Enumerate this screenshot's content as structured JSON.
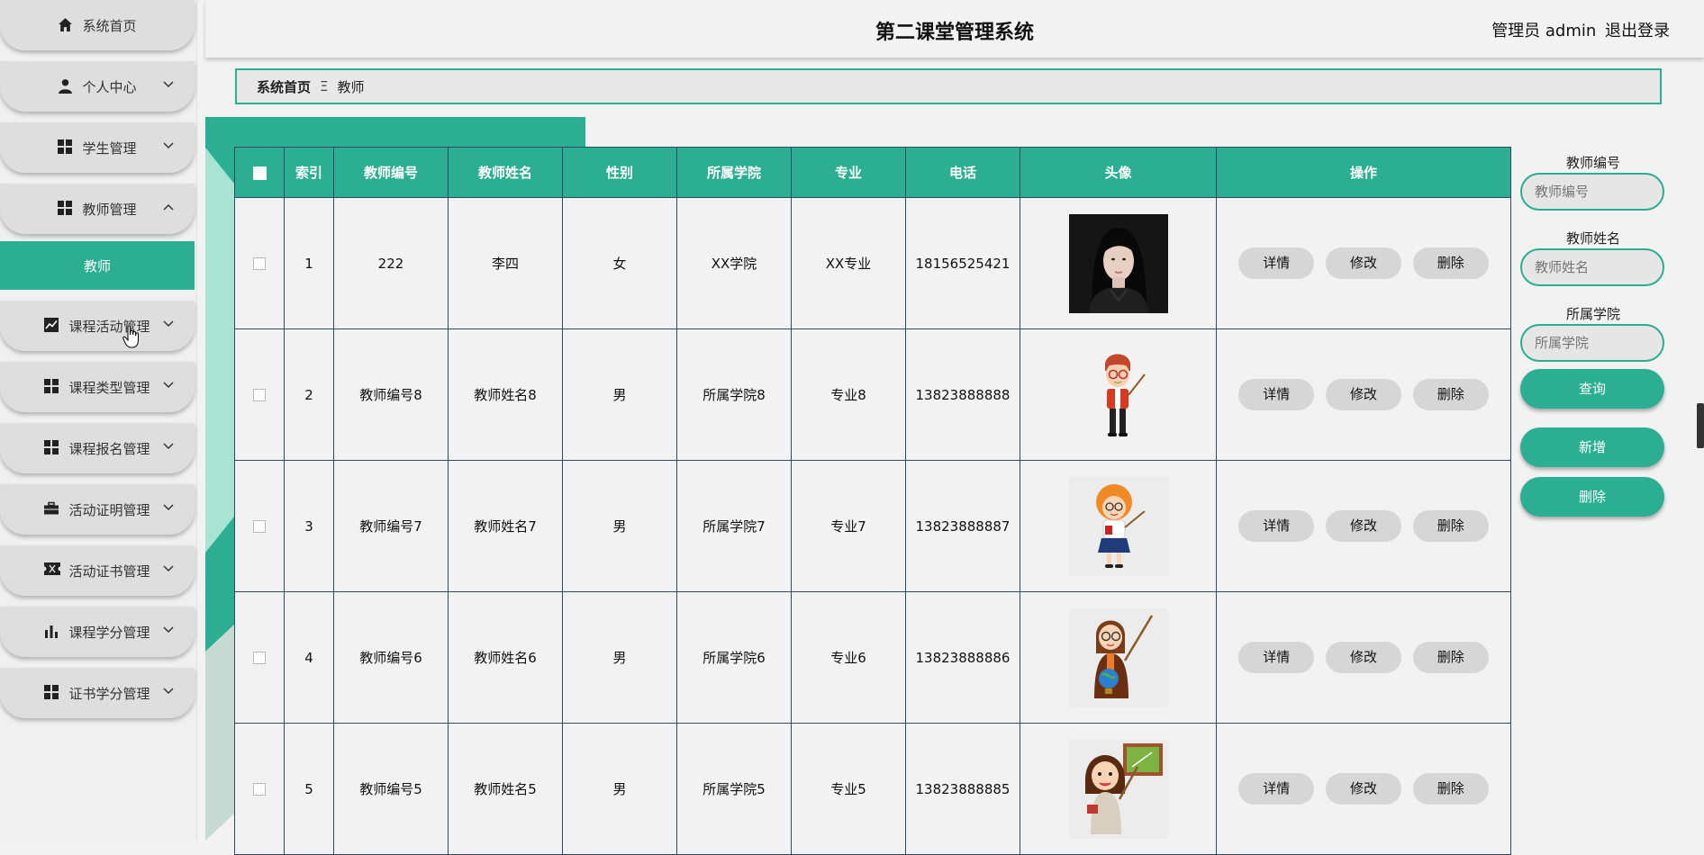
{
  "app": {
    "title": "第二课堂管理系统",
    "user_label": "管理员 admin",
    "logout_label": "退出登录"
  },
  "sidebar": {
    "items": [
      {
        "label": "系统首页",
        "icon": "home-icon"
      },
      {
        "label": "个人中心",
        "icon": "person-icon"
      },
      {
        "label": "学生管理",
        "icon": "grid-icon"
      },
      {
        "label": "教师管理",
        "icon": "grid-icon"
      },
      {
        "label": "教师",
        "icon": ""
      },
      {
        "label": "课程活动管理",
        "icon": "chart-line-icon"
      },
      {
        "label": "课程类型管理",
        "icon": "grid-icon"
      },
      {
        "label": "课程报名管理",
        "icon": "grid-icon"
      },
      {
        "label": "活动证明管理",
        "icon": "briefcase-icon"
      },
      {
        "label": "活动证书管理",
        "icon": "ticket-icon"
      },
      {
        "label": "课程学分管理",
        "icon": "bar-chart-icon"
      },
      {
        "label": "证书学分管理",
        "icon": "grid-icon"
      }
    ]
  },
  "breadcrumb": {
    "home": "系统首页",
    "separator": "Ξ",
    "current": "教师"
  },
  "table": {
    "headers": [
      "索引",
      "教师编号",
      "教师姓名",
      "性别",
      "所属学院",
      "专业",
      "电话",
      "头像",
      "操作"
    ],
    "rows": [
      {
        "index": "1",
        "code": "222",
        "name": "李四",
        "gender": "女",
        "college": "XX学院",
        "major": "XX专业",
        "phone": "18156525421",
        "avatar": "photo-woman"
      },
      {
        "index": "2",
        "code": "教师编号8",
        "name": "教师姓名8",
        "gender": "男",
        "college": "所属学院8",
        "major": "专业8",
        "phone": "13823888888",
        "avatar": "cartoon-teacher-man"
      },
      {
        "index": "3",
        "code": "教师编号7",
        "name": "教师姓名7",
        "gender": "男",
        "college": "所属学院7",
        "major": "专业7",
        "phone": "13823888887",
        "avatar": "cartoon-teacher-girl"
      },
      {
        "index": "4",
        "code": "教师编号6",
        "name": "教师姓名6",
        "gender": "男",
        "college": "所属学院6",
        "major": "专业6",
        "phone": "13823888886",
        "avatar": "cartoon-teacher-globe"
      },
      {
        "index": "5",
        "code": "教师编号5",
        "name": "教师姓名5",
        "gender": "男",
        "college": "所属学院5",
        "major": "专业5",
        "phone": "13823888885",
        "avatar": "cartoon-teacher-board"
      }
    ],
    "actions": {
      "detail": "详情",
      "edit": "修改",
      "delete": "删除"
    }
  },
  "search": {
    "code_label": "教师编号",
    "code_placeholder": "教师编号",
    "name_label": "教师姓名",
    "name_placeholder": "教师姓名",
    "college_label": "所属学院",
    "college_placeholder": "所属学院",
    "query_label": "查询",
    "add_label": "新增",
    "delete_label": "删除"
  },
  "colors": {
    "accent": "#2cae93",
    "border": "#2d4a63"
  }
}
